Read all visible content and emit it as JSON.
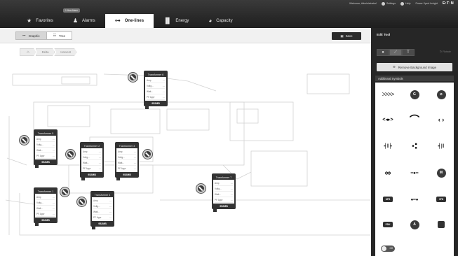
{
  "header": {
    "util": {
      "welcome": "Welcome, Administrator!",
      "settings": "Settings",
      "help": "Help",
      "power": "Power Xpert Insight",
      "brand": "E:T·N"
    },
    "badge": "1 New Alarm",
    "tabs": [
      {
        "label": "Favorites",
        "icon": "star-icon"
      },
      {
        "label": "Alarms",
        "icon": "bell-icon"
      },
      {
        "label": "One-lines",
        "icon": "one-line-icon"
      },
      {
        "label": "Energy",
        "icon": "bar-chart-icon"
      },
      {
        "label": "Capacity",
        "icon": "pie-icon"
      }
    ]
  },
  "toolbar": {
    "views": [
      {
        "label": "Graphic"
      },
      {
        "label": "Tree"
      }
    ],
    "save": "Save"
  },
  "breadcrumb": [
    "Delta",
    "Harvest"
  ],
  "transformers": [
    {
      "title": "Transformer 6",
      "rows": [
        "Amp",
        "Voltg...",
        "Watt...",
        "PF Appr"
      ],
      "footer": "952MB"
    },
    {
      "title": "Transformer 5",
      "rows": [
        "Amp",
        "Voltg...",
        "Watt...",
        "PF Appr"
      ],
      "footer": "952MB"
    },
    {
      "title": "Transformer 2",
      "rows": [
        "Amp",
        "Voltg...",
        "Watt...",
        "PF Appr"
      ],
      "footer": "952MB"
    },
    {
      "title": "Transformer 3",
      "rows": [
        "Amp",
        "Voltg...",
        "Watt...",
        "PF Appr"
      ],
      "footer": "952MB"
    },
    {
      "title": "Transformer 1",
      "rows": [
        "Amp",
        "Voltg...",
        "Watt...",
        "PF Appr"
      ],
      "footer": "952MB"
    },
    {
      "title": "Transformer 4",
      "rows": [
        "Amp",
        "Voltg...",
        "Watt...",
        "PF Appr"
      ],
      "footer": "952MB"
    },
    {
      "title": "Transformer 7",
      "rows": [
        "Amp",
        "Voltg...",
        "Watt...",
        "PF Appr"
      ],
      "footer": "952MB"
    }
  ],
  "panel": {
    "title": "Edit Tool",
    "tools": [
      "pin-icon",
      "line-icon",
      "text-icon"
    ],
    "tools_right": "Rotate",
    "remove_bg": "Remove Background Image",
    "additional": "Additional Symbols",
    "symbols": [
      {
        "name": "wire-symbol",
        "kind": "text",
        "text": "ᐳᐳᐳᐳ"
      },
      {
        "name": "generator-symbol",
        "kind": "circle",
        "text": "G"
      },
      {
        "name": "no-symbol",
        "kind": "circle",
        "text": "⊘"
      },
      {
        "name": "cable-symbol",
        "kind": "text",
        "text": "<◂▸>"
      },
      {
        "name": "arc-symbol",
        "kind": "text",
        "text": "⌒"
      },
      {
        "name": "arrows-symbol",
        "kind": "text",
        "text": "‹ ›"
      },
      {
        "name": "capacitor-symbol",
        "kind": "text",
        "text": "┥‖┝"
      },
      {
        "name": "dots-symbol",
        "kind": "text",
        "text": "⁖"
      },
      {
        "name": "battery-symbol",
        "kind": "text",
        "text": "┥|‖"
      },
      {
        "name": "coupling-symbol",
        "kind": "text",
        "text": "∞"
      },
      {
        "name": "busbar-symbol",
        "kind": "text",
        "text": "━●━"
      },
      {
        "name": "motor-symbol",
        "kind": "circle",
        "text": "M"
      },
      {
        "name": "ups-symbol",
        "kind": "box",
        "text": "UPS"
      },
      {
        "name": "link-symbol",
        "kind": "text",
        "text": "●━●"
      },
      {
        "name": "vfd-symbol",
        "kind": "box",
        "text": "VFD"
      },
      {
        "name": "pdu-symbol",
        "kind": "box",
        "text": "PDU"
      },
      {
        "name": "ammeter-symbol",
        "kind": "circle",
        "text": "A"
      },
      {
        "name": "block-symbol",
        "kind": "square",
        "text": ""
      },
      {
        "name": "toggle-symbol",
        "kind": "toggle",
        "text": "Off"
      }
    ]
  },
  "colors": {
    "header": "#2b2b2b",
    "panel": "#262626",
    "active_tab": "#ffffff"
  }
}
